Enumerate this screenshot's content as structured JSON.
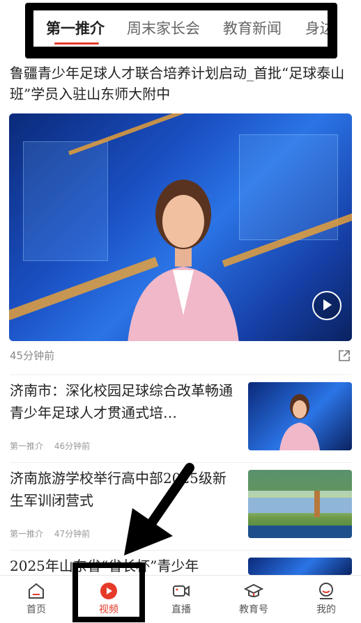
{
  "tabs": {
    "items": [
      "第一推介",
      "周末家长会",
      "教育新闻",
      "身边"
    ],
    "active_index": 0,
    "accent": "#e53a2a"
  },
  "headline": {
    "title": "鲁疆青少年足球人才联合培养计划启动_首批“足球泰山班”学员入驻山东师大附中",
    "time": "45分钟前",
    "icon": "share-icon"
  },
  "list": [
    {
      "title": "济南市：深化校园足球综合改革畅通青少年足球人才贯通式培…",
      "source": "第一推介",
      "time": "46分钟前"
    },
    {
      "title": "济南旅游学校举行高中部2025级新生军训闭营式",
      "source": "第一推介",
      "time": "47分钟前"
    },
    {
      "title": "2025年山东省“省长杯”青少年"
    }
  ],
  "bottom_nav": [
    {
      "label": "首页",
      "icon": "home-icon"
    },
    {
      "label": "视频",
      "icon": "video-play-icon",
      "active": true
    },
    {
      "label": "直播",
      "icon": "camera-icon"
    },
    {
      "label": "教育号",
      "icon": "graduation-cap-icon"
    },
    {
      "label": "我的",
      "icon": "profile-icon"
    }
  ]
}
